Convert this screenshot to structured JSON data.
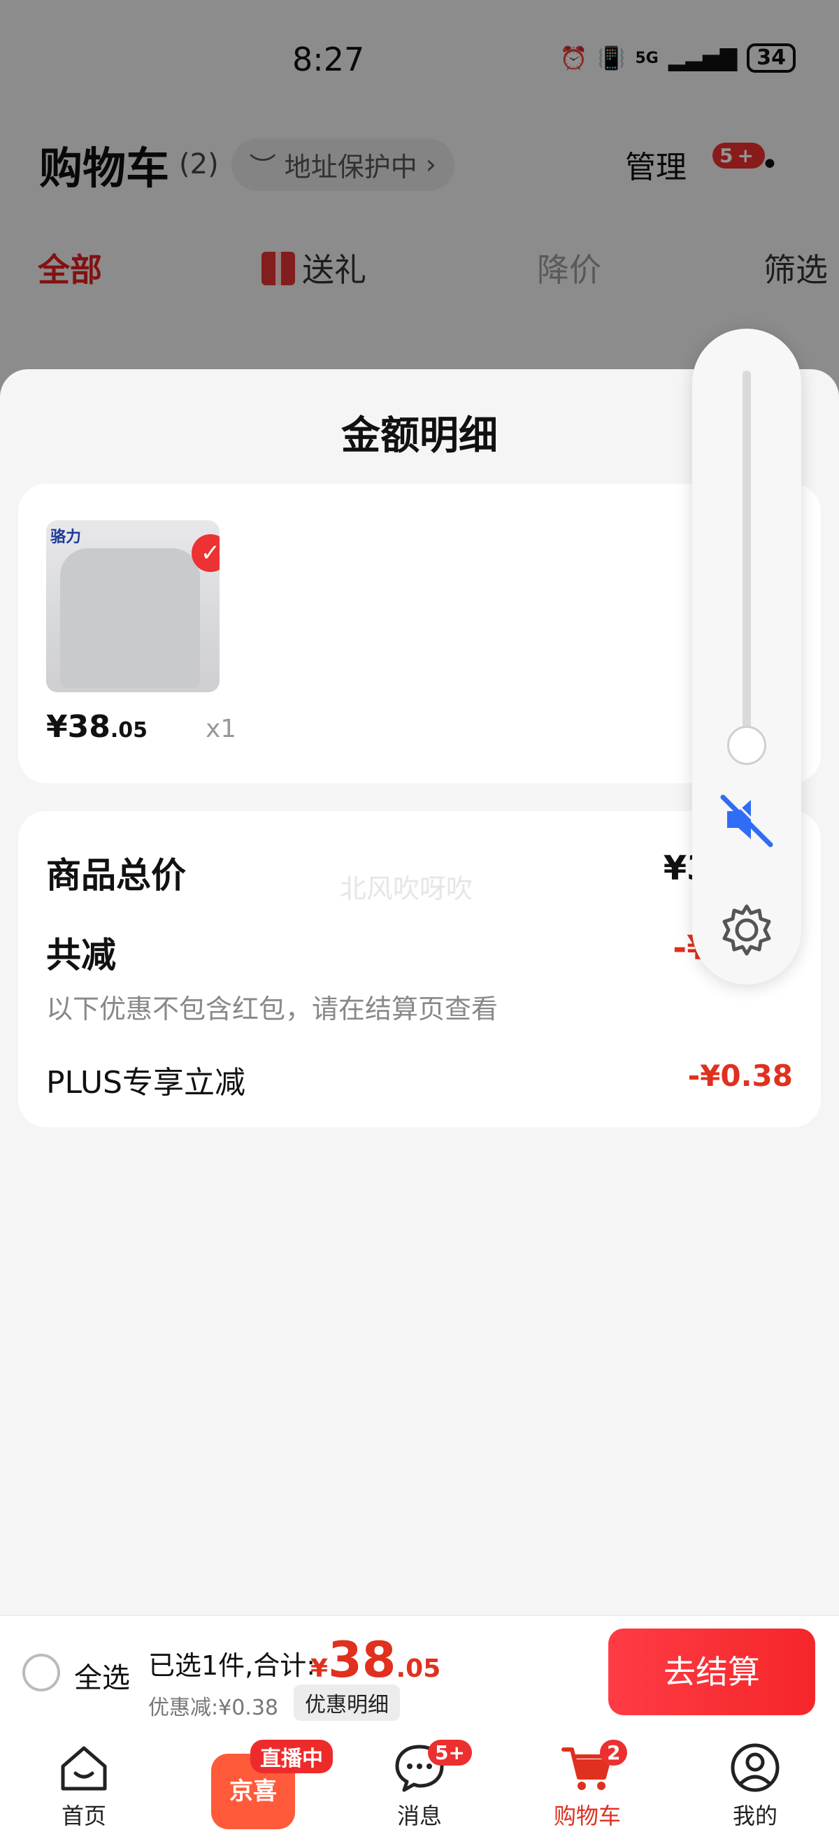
{
  "status_bar": {
    "time": "8:27",
    "network": "5G",
    "battery": "34"
  },
  "header": {
    "title": "购物车",
    "count": "(2)",
    "address_protect": "地址保护中",
    "manage": "管理",
    "badge": "5+"
  },
  "tabs": [
    {
      "label": "全部"
    },
    {
      "label": "送礼"
    },
    {
      "label": "降价"
    },
    {
      "label": "筛选"
    }
  ],
  "sheet": {
    "title": "金额明细",
    "product": {
      "brand_logo": "骆力",
      "price_int": "¥38",
      "price_dec": ".05",
      "qty": "x1"
    },
    "summary": {
      "total_label": "商品总价",
      "total_value": "¥38.43",
      "discount_label": "共减",
      "discount_value": "-¥0.38",
      "note": "以下优惠不包含红包，请在结算页查看",
      "plus_label": "PLUS专享立减",
      "plus_value": "-¥0.38",
      "watermark": "北风吹呀吹"
    }
  },
  "checkout": {
    "select_all": "全选",
    "selected": "已选1件,合计:",
    "currency": "¥",
    "total_int": "38",
    "total_dec": ".05",
    "discount": "优惠减:¥0.38",
    "detail": "优惠明细",
    "button": "去结算"
  },
  "nav": {
    "home": "首页",
    "live_tag": "直播中",
    "live_box": "京喜",
    "messages": "消息",
    "messages_badge": "5+",
    "cart": "购物车",
    "cart_badge": "2",
    "mine": "我的"
  },
  "colors": {
    "accent": "#e0301e",
    "button": "#f5262a",
    "icon_blue": "#2f6df6"
  }
}
